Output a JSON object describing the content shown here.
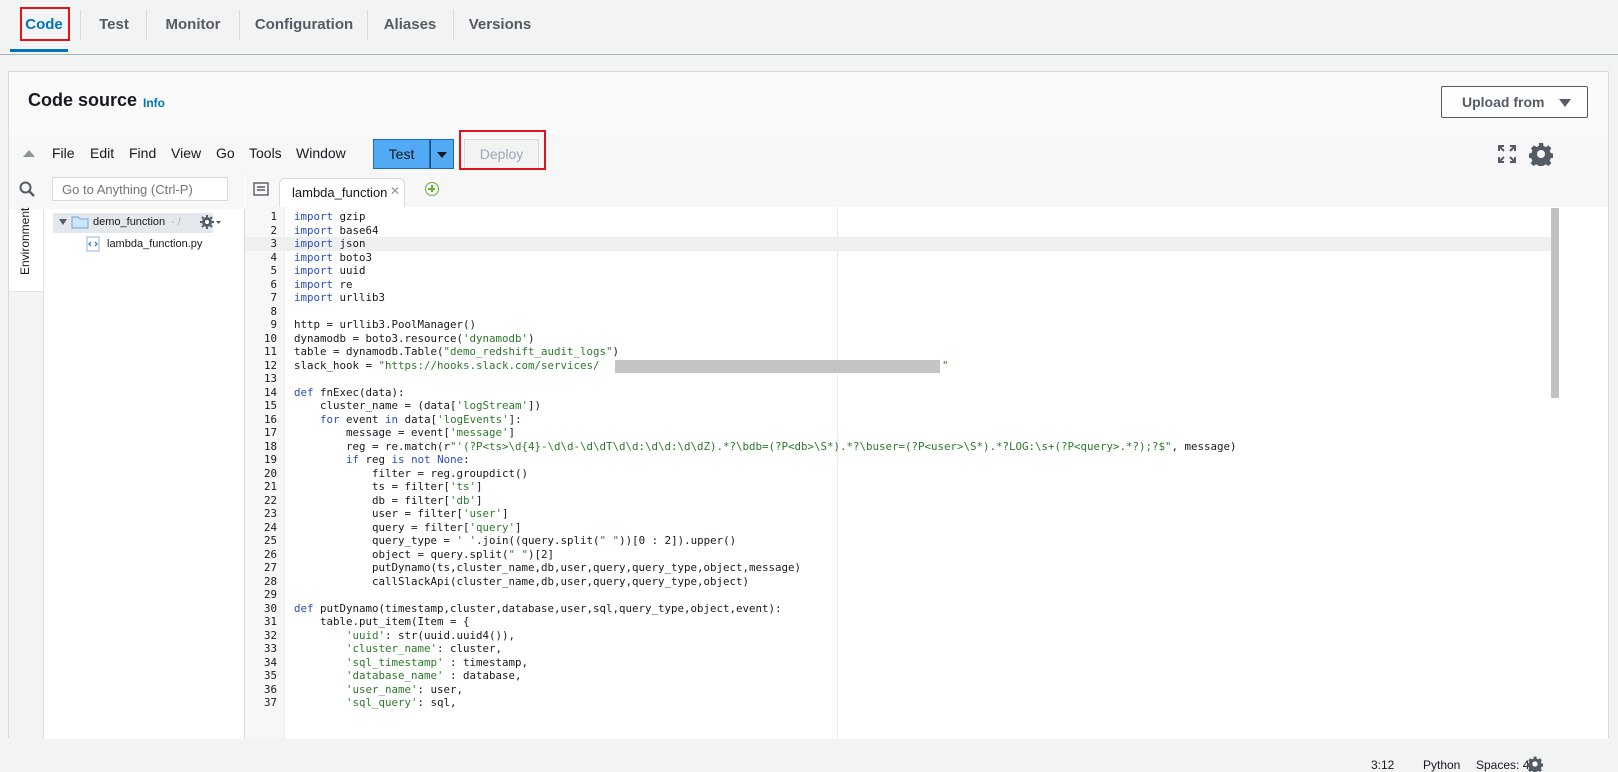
{
  "tabs": [
    "Code",
    "Test",
    "Monitor",
    "Configuration",
    "Aliases",
    "Versions"
  ],
  "code_source": {
    "title": "Code source",
    "info": "Info",
    "upload_label": "Upload from"
  },
  "menu": {
    "items": [
      "File",
      "Edit",
      "Find",
      "View",
      "Go",
      "Tools",
      "Window"
    ],
    "test_label": "Test",
    "deploy_label": "Deploy"
  },
  "sidebar": {
    "search_placeholder": "Go to Anything (Ctrl-P)",
    "environment_label": "Environment",
    "folder_name": "demo_function",
    "folder_path": "- /",
    "file_name": "lambda_function.py"
  },
  "editor": {
    "tab_label": "lambda_function",
    "code_lines": [
      "import gzip",
      "import base64",
      "import json",
      "import boto3",
      "import uuid",
      "import re",
      "import urllib3",
      "",
      "http = urllib3.PoolManager()",
      "dynamodb = boto3.resource('dynamodb')",
      "table = dynamodb.Table(\"demo_redshift_audit_logs\")",
      "slack_hook = \"https://hooks.slack.com/services/",
      "",
      "def fnExec(data):",
      "    cluster_name = (data['logStream'])",
      "    for event in data['logEvents']:",
      "        message = event['message']",
      "        reg = re.match(r\"'(?P<ts>\\d{4}-\\d\\d-\\d\\dT\\d\\d:\\d\\d:\\d\\dZ).*?\\bdb=(?P<db>\\S*).*?\\buser=(?P<user>\\S*).*?LOG:\\s+(?P<query>.*?);?$\", message)",
      "        if reg is not None:",
      "            filter = reg.groupdict()",
      "            ts = filter['ts']",
      "            db = filter['db']",
      "            user = filter['user']",
      "            query = filter['query']",
      "            query_type = ' '.join((query.split(\" \"))[0 : 2]).upper()",
      "            object = query.split(\" \")[2]",
      "            putDynamo(ts,cluster_name,db,user,query,query_type,object,message)",
      "            callSlackApi(cluster_name,db,user,query,query_type,object)",
      "",
      "def putDynamo(timestamp,cluster,database,user,sql,query_type,object,event):",
      "    table.put_item(Item = {",
      "        'uuid': str(uuid.uuid4()),",
      "        'cluster_name': cluster,",
      "        'sql_timestamp' : timestamp,",
      "        'database_name' : database,",
      "        'user_name': user,",
      "        'sql_query': sql,"
    ],
    "redacted_tail": "\""
  },
  "status_bar": {
    "cursor": "3:12",
    "language": "Python",
    "spaces": "Spaces: 4"
  }
}
